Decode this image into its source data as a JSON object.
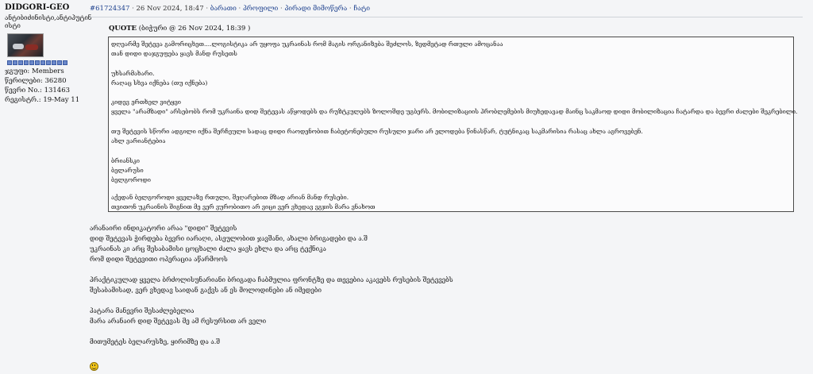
{
  "author": {
    "name": "DIDGORI-GEO",
    "title_line1": "ანტიბიძინისტი,ანტიპუტინ",
    "title_line2": "ისტი",
    "group": "ჯგუფი: Members",
    "posts": "წერილები: 36280",
    "member_no": "წევრი No.: 131463",
    "registered": "რეგისტრ.: 19-May 11"
  },
  "header": {
    "post_id": "#61724347",
    "date": "26 Nov 2024, 18:47",
    "actions": [
      "ბარათი",
      "პროფილი",
      "პირადი მიმოწერა",
      "ჩატი"
    ]
  },
  "quote": {
    "label": "QUOTE",
    "meta": "(ბიჭური @ 26 Nov 2024, 18:39 )",
    "lines": [
      "დღეარმე შეტევა გამორიცხეთ....ლოგისტიკა არ უყოფა უკრაინას რომ მაგის ორგანიზება შეძლოს, ზედმეტად რთული ამოცანაა",
      "თან დიდი დაჯგუფება ყავს მანდ რუსეთს",
      "",
      "უხსარმახარი.",
      "რაღაც სხვა იქნება (თუ იქნება)",
      "",
      "კიდევ ერთხელ ვიტყვი",
      "ყველა \"არამზადი\" არსებობს რომ უკრაინა დიდ შეტევას აწყოდებს და რუზტკულებს ზოლოშდე უგბერს. მობილიზაციის პრობლემების მიუხედავად მაინც საკმაოდ დიდი მობილიზაცია ჩატარდა და ბევრი ძალები შეკრებილი.",
      "",
      "თუ შეტევის სწორი ადგილი იქნა შერჩეული სადაც დიდი რაოდენობით ჩაბეტონებული რუსული ჯარი არ ელოდება წინასწარ, ტუტნიკაც საკმარისია რასაც ახლა აგროვებენ.",
      "ახლ ვარიანტებია",
      "",
      "ბრიანსკი",
      "ბელარუსი",
      "ბელგოროდი",
      "",
      "აქედან ბელგოროდი ყველაზე რთული, შეღარებით მზად არიან მანდ რუსები.",
      "თვითონ უკრაინის შიგნით მე ვერ ვურობითო არ ვიცი ვერ ვხედავ ვგჯის მარა ვნახოთ"
    ]
  },
  "body_lines": [
    "არანაირი ინდიკატორი არაა \"დიდი\" შეტევის",
    "დიდ შეტევას ჭირდება ბევრი იარაღი, ასეულობით ჯავშანი, ახალი ბრიგადები და ა.შ",
    "უკრაინას კი არც შესაბამისი ცოცხალი ძალა ყავს ეხლა და არც ტექნიკა",
    "რომ დიდი შეტევითი ოპერაცია აწარმოოს",
    "",
    "პრაქტიკულად ყველა ბრძოლისუნარიანი ბრიგადა ჩაბმულია ფრონტზე და თევებია აკავებს რუსების შეტევებს",
    "შესაბამისად, ვერ ვხედავ საიდან გაქვს ან ეს მოლოდინები ან იმედები",
    "",
    "პატარა მანევრი შესაძლებელია",
    "მარა არანაირ დიდ შეტევას მე ამ რესურსით არ ველი",
    "",
    "მითუმეტეს ბელარუსზე, ყირიმზე და ა.შ"
  ],
  "colors": {
    "link": "#1a3e8c",
    "border": "#4a4a4a",
    "background": "#f4f5f7"
  },
  "icons": [
    "smiley-icon"
  ]
}
